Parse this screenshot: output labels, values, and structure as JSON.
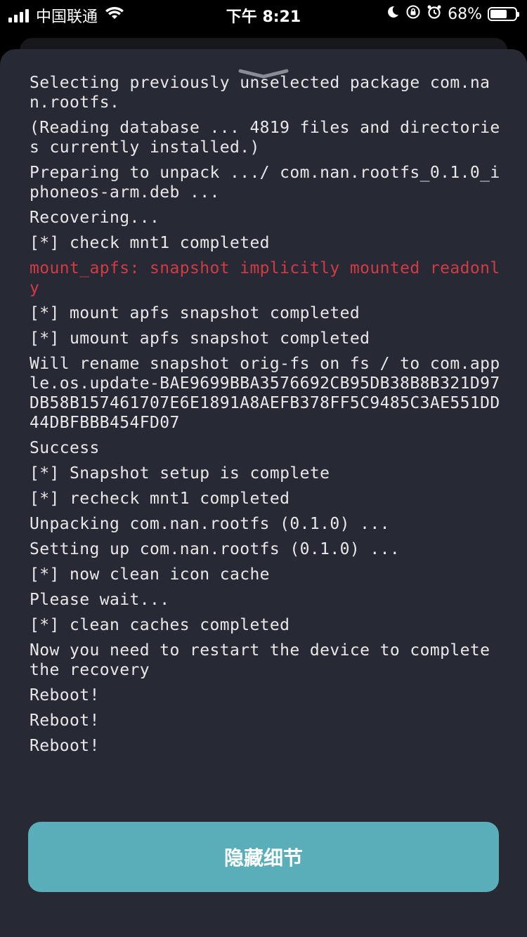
{
  "status_bar": {
    "carrier": "中国联通",
    "time": "下午 8:21",
    "battery_percent": "68%",
    "battery_level": 0.68
  },
  "log": [
    {
      "text": "Selecting previously unselected package com.nan.rootfs.",
      "error": false
    },
    {
      "text": "(Reading database ... 4819 files and directories currently installed.)",
      "error": false
    },
    {
      "text": "Preparing to unpack .../ com.nan.rootfs_0.1.0_iphoneos-arm.deb ...",
      "error": false
    },
    {
      "text": "Recovering...",
      "error": false
    },
    {
      "text": "[*] check mnt1 completed",
      "error": false
    },
    {
      "text": "mount_apfs: snapshot implicitly mounted readonly",
      "error": true
    },
    {
      "text": "[*] mount apfs snapshot completed",
      "error": false
    },
    {
      "text": "[*] umount apfs snapshot completed",
      "error": false
    },
    {
      "text": "Will rename snapshot orig-fs on fs / to com.apple.os.update-BAE9699BBA3576692CB95DB38B8B321D97DB58B157461707E6E1891A8AEFB378FF5C9485C3AE551DD44DBFBBB454FD07",
      "error": false
    },
    {
      "text": "Success",
      "error": false
    },
    {
      "text": "[*] Snapshot setup is complete",
      "error": false
    },
    {
      "text": "[*] recheck mnt1 completed",
      "error": false
    },
    {
      "text": "Unpacking com.nan.rootfs (0.1.0) ...",
      "error": false
    },
    {
      "text": "Setting up com.nan.rootfs (0.1.0) ...",
      "error": false
    },
    {
      "text": "[*] now clean icon cache",
      "error": false
    },
    {
      "text": "Please wait...",
      "error": false
    },
    {
      "text": "[*] clean caches completed",
      "error": false
    },
    {
      "text": "Now you need to restart the device to complete the recovery",
      "error": false
    },
    {
      "text": "Reboot!",
      "error": false
    },
    {
      "text": "Reboot!",
      "error": false
    },
    {
      "text": "Reboot!",
      "error": false
    }
  ],
  "button": {
    "label": "隐藏细节"
  },
  "colors": {
    "sheet": "#272a34",
    "accent": "#5aaeb9",
    "error": "#d33a44"
  }
}
